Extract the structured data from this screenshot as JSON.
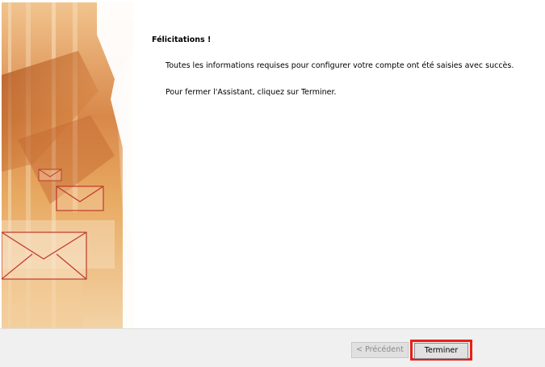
{
  "wizard": {
    "heading": "Félicitations !",
    "message": "Toutes les informations requises pour configurer votre compte ont été saisies avec succès.",
    "instruction": "Pour fermer l'Assistant, cliquez sur Terminer."
  },
  "footer": {
    "back_label": "< Précédent",
    "finish_label": "Terminer"
  },
  "colors": {
    "highlight": "#e8201a",
    "banner_orange": "#d67a3a"
  }
}
